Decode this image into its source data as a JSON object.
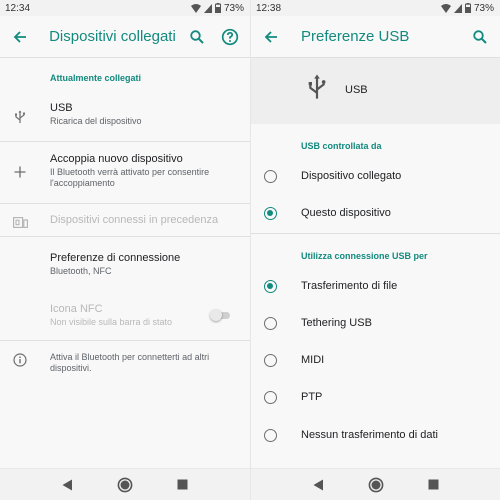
{
  "colors": {
    "accent": "#128a7e",
    "text": "#202124",
    "secondary": "#5f6368",
    "disabled": "#b8b8b8"
  },
  "left": {
    "status": {
      "time": "12:34",
      "battery": "73%"
    },
    "appbar": {
      "title": "Dispositivi collegati",
      "icons": [
        "back-arrow-icon",
        "search-icon",
        "help-icon"
      ]
    },
    "section_header": "Attualmente collegati",
    "items": [
      {
        "title": "USB",
        "subtitle": "Ricarica del dispositivo",
        "icon": "usb-icon"
      },
      {
        "title": "Accoppia nuovo dispositivo",
        "subtitle": "Il Bluetooth verrà attivato per consentire l'accoppiamento",
        "icon": "plus-icon"
      },
      {
        "title": "Dispositivi connessi in precedenza",
        "icon": "devices-icon"
      },
      {
        "title": "Preferenze di connessione",
        "subtitle": "Bluetooth, NFC"
      },
      {
        "title": "Icona NFC",
        "subtitle": "Non visibile sulla barra di stato",
        "toggle_on": false
      }
    ],
    "footer_info": "Attiva il Bluetooth per connetterti ad altri dispositivi."
  },
  "right": {
    "status": {
      "time": "12:38",
      "battery": "73%"
    },
    "appbar": {
      "title": "Preferenze USB",
      "icons": [
        "back-arrow-icon",
        "search-icon"
      ]
    },
    "usb_label": "USB",
    "section1_header": "USB controllata da",
    "controlled_by": [
      {
        "label": "Dispositivo collegato",
        "selected": false
      },
      {
        "label": "Questo dispositivo",
        "selected": true
      }
    ],
    "section2_header": "Utilizza connessione USB per",
    "usb_modes": [
      {
        "label": "Trasferimento di file",
        "selected": true
      },
      {
        "label": "Tethering USB",
        "selected": false
      },
      {
        "label": "MIDI",
        "selected": false
      },
      {
        "label": "PTP",
        "selected": false
      },
      {
        "label": "Nessun trasferimento di dati",
        "selected": false
      }
    ]
  },
  "navbar_icons": [
    "back-triangle-icon",
    "home-circle-icon",
    "recents-square-icon"
  ]
}
